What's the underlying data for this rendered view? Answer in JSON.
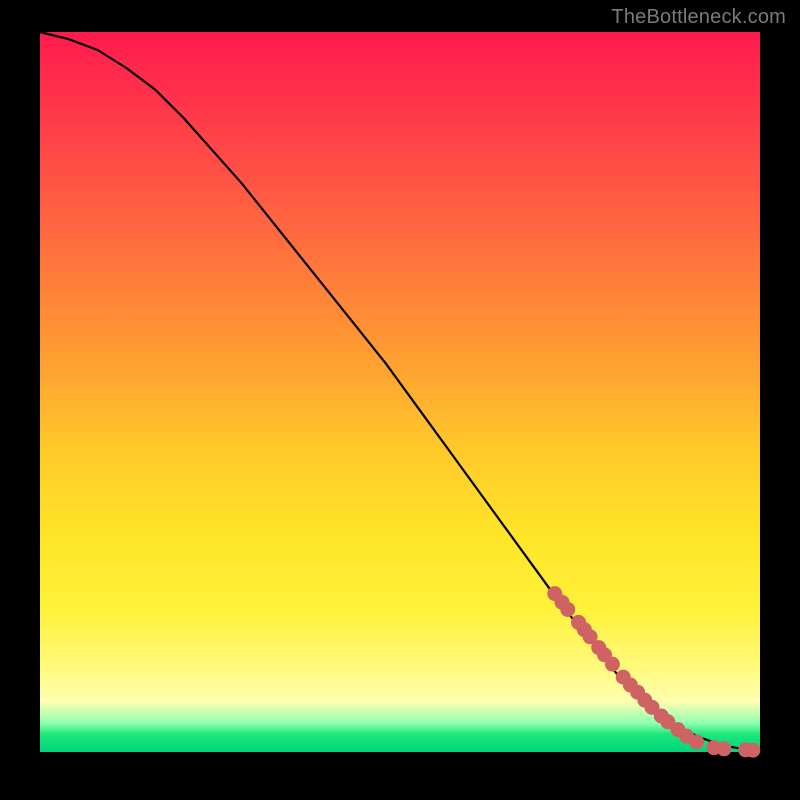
{
  "watermark": "TheBottleneck.com",
  "colors": {
    "background": "#000000",
    "curve": "#000000",
    "dots": "#cf6363"
  },
  "chart_data": {
    "type": "line",
    "title": "",
    "xlabel": "",
    "ylabel": "",
    "xlim": [
      0,
      100
    ],
    "ylim": [
      0,
      100
    ],
    "grid": false,
    "legend": false,
    "series": [
      {
        "name": "curve",
        "x": [
          0,
          4,
          8,
          12,
          16,
          20,
          24,
          28,
          32,
          36,
          40,
          44,
          48,
          52,
          56,
          60,
          64,
          68,
          72,
          76,
          80,
          84,
          88,
          90,
          92,
          94,
          96,
          98,
          100
        ],
        "y": [
          100,
          99,
          97.5,
          95,
          92,
          88,
          83.5,
          79,
          74,
          69,
          64,
          59,
          54,
          48.5,
          43,
          37.5,
          32,
          26.5,
          21,
          16,
          11,
          7,
          4,
          2.8,
          1.9,
          1.2,
          0.7,
          0.35,
          0.2
        ]
      }
    ],
    "highlight_points": {
      "name": "dots",
      "x": [
        71.5,
        72.5,
        73.3,
        74.8,
        75.6,
        76.4,
        77.6,
        78.4,
        79.5,
        81.0,
        82.0,
        83.0,
        84.0,
        85.0,
        86.3,
        87.2,
        88.6,
        89.8,
        91.2,
        93.6,
        95.0,
        98.0,
        99.0
      ],
      "y": [
        22.0,
        20.8,
        19.8,
        18.0,
        17.0,
        16.0,
        14.5,
        13.5,
        12.2,
        10.4,
        9.3,
        8.3,
        7.2,
        6.2,
        5.0,
        4.2,
        3.1,
        2.2,
        1.4,
        0.6,
        0.45,
        0.3,
        0.25
      ]
    }
  }
}
